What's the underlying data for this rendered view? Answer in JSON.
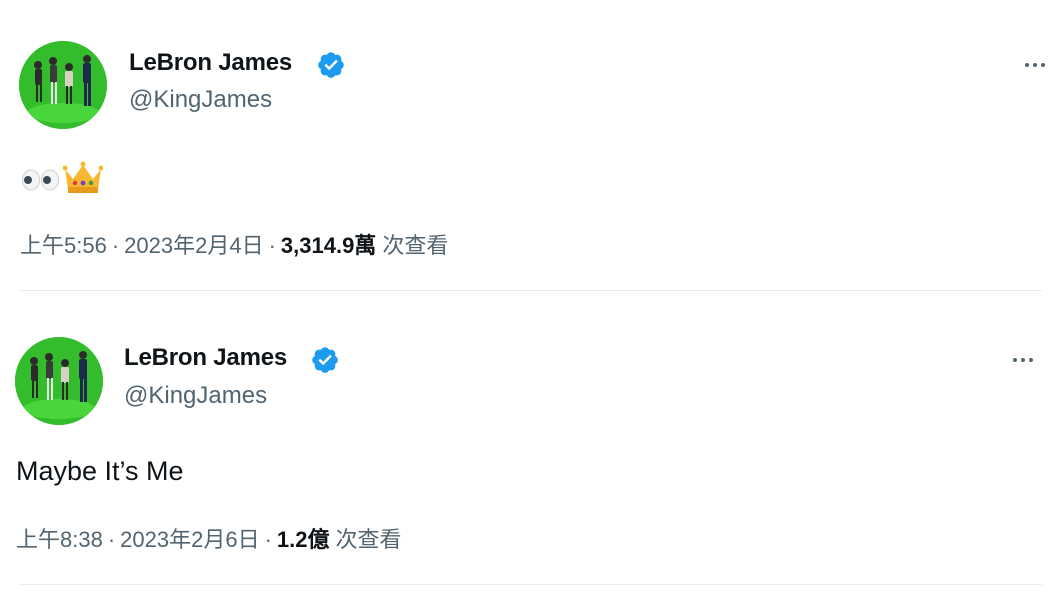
{
  "tweets": [
    {
      "author": {
        "name": "LeBron James",
        "handle": "@KingJames",
        "verified": true
      },
      "content": {
        "text": "",
        "emojis": [
          "eyes-emoji",
          "crown-emoji"
        ]
      },
      "meta": {
        "time": "上午5:56",
        "date": "2023年2月4日",
        "separator": "·",
        "views_count": "3,314.9萬",
        "views_label": "次查看"
      },
      "more_icon": "ellipsis-icon"
    },
    {
      "author": {
        "name": "LeBron James",
        "handle": "@KingJames",
        "verified": true
      },
      "content": {
        "text": "Maybe It’s Me"
      },
      "meta": {
        "time": "上午8:38",
        "date": "2023年2月6日",
        "separator": "·",
        "views_count": "1.2億",
        "views_label": "次查看"
      },
      "more_icon": "ellipsis-icon"
    }
  ],
  "colors": {
    "verified_blue": "#1d9bf0",
    "secondary_text": "#536471",
    "primary_text": "#0f1419",
    "divider": "#e6ecf0",
    "avatar_green": "#34c02a"
  }
}
